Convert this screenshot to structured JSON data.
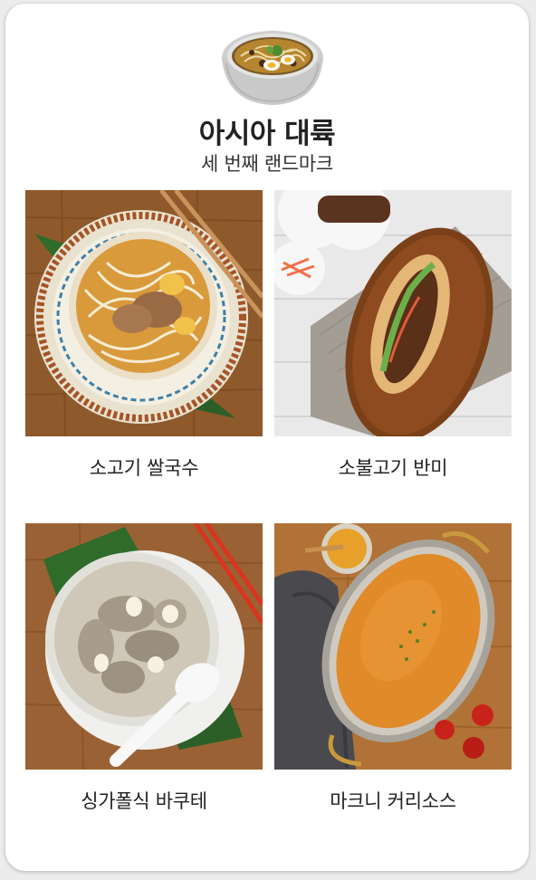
{
  "header": {
    "icon": "soup-bowl-icon",
    "title": "아시아 대륙",
    "subtitle": "세 번째 랜드마크"
  },
  "items": [
    {
      "label": "소고기 쌀국수",
      "icon": "pho-noodle-photo"
    },
    {
      "label": "소불고기 반미",
      "icon": "banh-mi-photo"
    },
    {
      "label": "싱가폴식 바쿠테",
      "icon": "bak-kut-teh-photo"
    },
    {
      "label": "마크니 커리소스",
      "icon": "makhani-curry-photo"
    }
  ],
  "colors": {
    "background": "#ececec",
    "card": "#ffffff",
    "text": "#222222"
  }
}
